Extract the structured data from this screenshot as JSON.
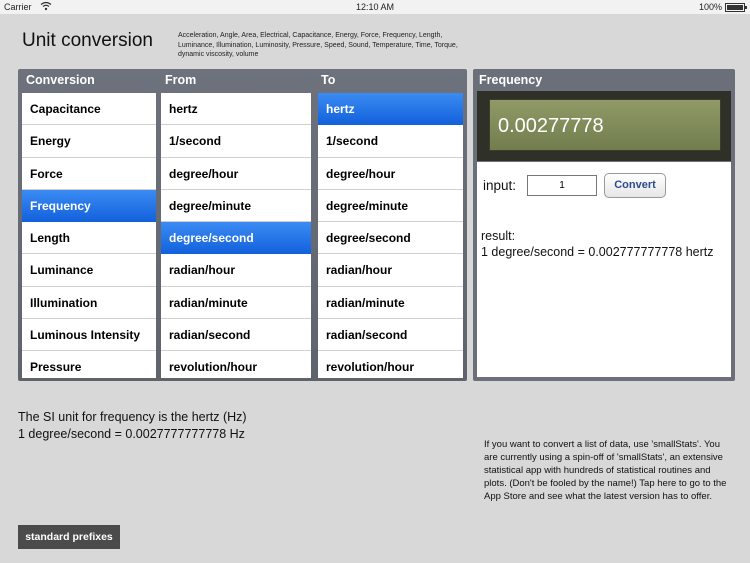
{
  "status_bar": {
    "carrier": "Carrier",
    "time": "12:10 AM",
    "battery": "100%"
  },
  "header": {
    "title": "Unit conversion",
    "categories": "Acceleration, Angle, Area, Electrical, Capacitance, Energy, Force, Frequency, Length, Luminance, Illumination, Luminosity, Pressure, Speed, Sound, Temperature, Time, Torque, dynamic viscosity, volume"
  },
  "picker": {
    "headers": {
      "conversion": "Conversion",
      "from": "From",
      "to": "To"
    },
    "conversion": [
      "Capacitance",
      "Energy",
      "Force",
      "Frequency",
      "Length",
      "Luminance",
      "Illumination",
      "Luminous Intensity",
      "Pressure"
    ],
    "from": [
      "hertz",
      "1/second",
      "degree/hour",
      "degree/minute",
      "degree/second",
      "radian/hour",
      "radian/minute",
      "radian/second",
      "revolution/hour"
    ],
    "to": [
      "hertz",
      "1/second",
      "degree/hour",
      "degree/minute",
      "degree/second",
      "radian/hour",
      "radian/minute",
      "radian/second",
      "revolution/hour"
    ],
    "selected": {
      "conversion": "Frequency",
      "from": "degree/second",
      "to": "hertz"
    }
  },
  "frequency_panel": {
    "title": "Frequency",
    "display": "0.00277778",
    "input_label": "input:",
    "input_value": "1",
    "convert_label": "Convert",
    "result_label": "result:",
    "result_value": "1 degree/second = 0.002777777778 hertz"
  },
  "info": {
    "si_line": "The SI unit for frequency is the hertz (Hz)",
    "conversion_line": "1 degree/second = 0.0027777777778 Hz"
  },
  "promo": "If you want to convert a list of data, use 'smallStats'. You are currently using a spin-off of 'smallStats', an extensive statistical app with hundreds of statistical routines and plots. (Don't be fooled by the name!) Tap here to go to the App Store and see what the latest version has to offer.",
  "prefix_button": "standard prefixes"
}
